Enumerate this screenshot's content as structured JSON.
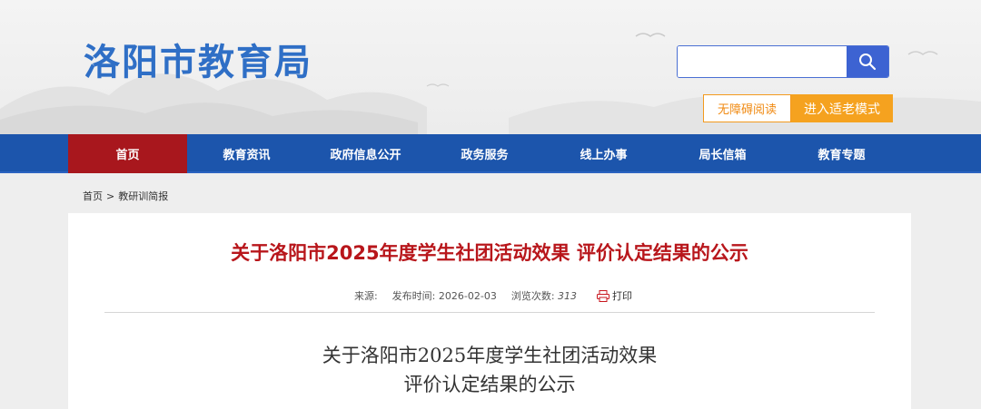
{
  "header": {
    "site_title": "洛阳市教育局",
    "search": {
      "placeholder": "",
      "value": ""
    },
    "accessible_label": "无障碍阅读",
    "elder_mode_label": "进入适老模式"
  },
  "nav": {
    "items": [
      {
        "label": "首页",
        "active": true
      },
      {
        "label": "教育资讯"
      },
      {
        "label": "政府信息公开"
      },
      {
        "label": "政务服务"
      },
      {
        "label": "线上办事"
      },
      {
        "label": "局长信箱"
      },
      {
        "label": "教育专题"
      }
    ]
  },
  "breadcrumb": {
    "home": "首页",
    "separator": ">",
    "current": "教研训简报"
  },
  "article": {
    "title": "关于洛阳市2025年度学生社团活动效果 评价认定结果的公示",
    "source_label": "来源:",
    "publish_label": "发布时间:",
    "publish_date": "2026-02-03",
    "views_label": "浏览次数:",
    "views": "313",
    "print_label": "打印",
    "body_title_line1": "关于洛阳市2025年度学生社团活动效果",
    "body_title_line2": "评价认定结果的公示"
  },
  "colors": {
    "brand_blue": "#1c55ac",
    "nav_active_red": "#a8171d",
    "title_red": "#b8161b",
    "accent_orange": "#f5a21f",
    "logo_blue": "#2f6fc6"
  }
}
